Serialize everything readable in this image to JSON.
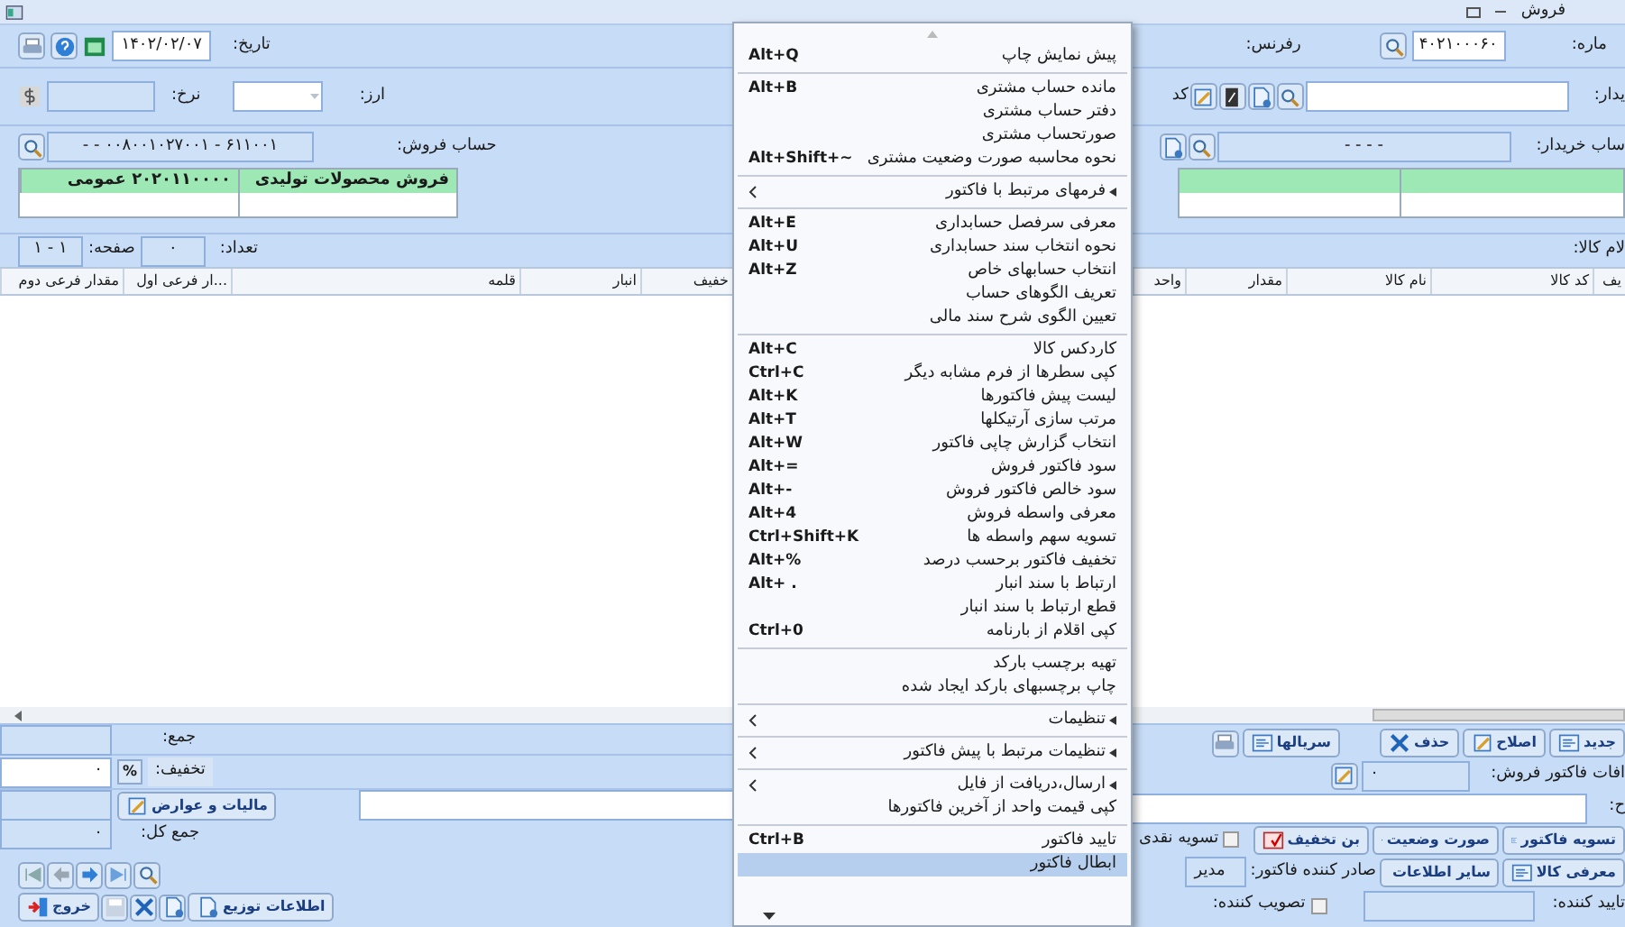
{
  "window": {
    "title": "فروش"
  },
  "date": {
    "label": "تاریخ:",
    "value": "۱۴۰۲/۰۲/۰۷"
  },
  "number": {
    "label": "ماره:",
    "value": "۴۰۲۱۰۰۰۶۰"
  },
  "reference": {
    "label": "رفرنس:"
  },
  "currency": {
    "label": "ارز:"
  },
  "rate": {
    "label": "نرخ:"
  },
  "buyer": {
    "label": "یدار:",
    "code_label": "کد"
  },
  "sales_account": {
    "label": "حساب فروش:",
    "value": "۶۱۱۰۰۱ - ۰۰۸۰۰۱۰۲۷۰۰۱ - -",
    "table": [
      "فروش محصولات تولیدی",
      "۲۰۲۰۱۱۰۰۰۰ عمومی"
    ]
  },
  "buyer_account": {
    "label": "ساب خریدار:",
    "value": "- - - -"
  },
  "paging": {
    "page": "۱ - ۱",
    "page_label": "صفحه:",
    "count": "۰",
    "count_label": "تعداد:"
  },
  "items_label": "لام کالا:",
  "table": {
    "columns": [
      "یف",
      "کد کالا",
      "نام کالا",
      "مقدار",
      "واحد",
      "خفیف",
      "انبار",
      "قلمه",
      "...ار فرعی اول",
      "مقدار فرعی دوم"
    ]
  },
  "totals": {
    "sum_label": "جمع:",
    "discount_label": "تخفیف:",
    "discount_percent": "%",
    "discount_value": "۰",
    "taxes_button": "مالیات و عوارض",
    "grand_total_label": "جمع کل:",
    "grand_total": "۰"
  },
  "exit_button": "خروج",
  "distribution_button": "اطلاعات توزیع",
  "actions": [
    "جدید",
    "اصلاح",
    "حذف",
    "سریالها"
  ],
  "additions": {
    "label": "افات فاکتور فروش:",
    "value": "۰"
  },
  "description_label": "ح:",
  "settle_buttons": [
    "تسویه فاکتور",
    "صورت وضعیت",
    "بن تخفیف"
  ],
  "info_buttons": [
    "معرفی کالا",
    "سایر اطلاعات"
  ],
  "cash_settlement": {
    "label": "تسویه نقدی",
    "checked": false
  },
  "issuer": {
    "label": "صادر کننده فاکتور:",
    "value": "مدیر"
  },
  "approver_label": "تایید کننده:",
  "ratifier": {
    "label": "تصویب کننده:",
    "checked": false
  },
  "menu": {
    "items": [
      {
        "kind": "item",
        "label": "پیش نمایش چاپ",
        "shortcut": "Alt+Q",
        "selected": false
      },
      {
        "kind": "separator"
      },
      {
        "kind": "item",
        "label": "مانده حساب مشتری",
        "shortcut": "Alt+B",
        "selected": false
      },
      {
        "kind": "item",
        "label": "دفتر حساب مشتری",
        "selected": false
      },
      {
        "kind": "item",
        "label": "صورتحساب مشتری",
        "selected": false
      },
      {
        "kind": "item",
        "label": "نحوه محاسبه صورت وضعیت مشتری",
        "shortcut": "Alt+Shift+~",
        "selected": false
      },
      {
        "kind": "separator"
      },
      {
        "kind": "submenu",
        "label": "فرمهای مرتبط با فاکتور",
        "selected": false
      },
      {
        "kind": "separator"
      },
      {
        "kind": "item",
        "label": "معرفی سرفصل حسابداری",
        "shortcut": "Alt+E",
        "selected": false
      },
      {
        "kind": "item",
        "label": "نحوه انتخاب سند حسابداری",
        "shortcut": "Alt+U",
        "selected": false
      },
      {
        "kind": "item",
        "label": "انتخاب حسابهای خاص",
        "shortcut": "Alt+Z",
        "selected": false
      },
      {
        "kind": "item",
        "label": "تعریف الگوهای حساب",
        "selected": false
      },
      {
        "kind": "item",
        "label": "تعیین الگوی شرح سند مالی",
        "selected": false
      },
      {
        "kind": "separator"
      },
      {
        "kind": "item",
        "label": "کاردکس کالا",
        "shortcut": "Alt+C",
        "selected": false
      },
      {
        "kind": "item",
        "label": "کپی سطرها از فرم مشابه دیگر",
        "shortcut": "Ctrl+C",
        "selected": false
      },
      {
        "kind": "item",
        "label": "لیست پیش فاکتورها",
        "shortcut": "Alt+K",
        "selected": false
      },
      {
        "kind": "item",
        "label": "مرتب سازی آرتیکلها",
        "shortcut": "Alt+T",
        "selected": false
      },
      {
        "kind": "item",
        "label": "انتخاب گزارش چاپی فاکتور",
        "shortcut": "Alt+W",
        "selected": false
      },
      {
        "kind": "item",
        "label": "سود فاکتور فروش",
        "shortcut": "Alt+=",
        "selected": false
      },
      {
        "kind": "item",
        "label": "سود خالص فاکتور فروش",
        "shortcut": "Alt+-",
        "selected": false
      },
      {
        "kind": "item",
        "label": "معرفی واسطه فروش",
        "shortcut": "Alt+4",
        "selected": false
      },
      {
        "kind": "item",
        "label": "تسویه سهم واسطه ها",
        "shortcut": "Ctrl+Shift+K",
        "selected": false
      },
      {
        "kind": "item",
        "label": "تخفیف فاکتور برحسب درصد",
        "shortcut": "Alt+%",
        "selected": false
      },
      {
        "kind": "item",
        "label": "ارتباط با سند انبار",
        "shortcut": "Alt+ .",
        "selected": false
      },
      {
        "kind": "item",
        "label": "قطع ارتباط با سند انبار",
        "selected": false
      },
      {
        "kind": "item",
        "label": "کپی اقلام از بارنامه",
        "shortcut": "Ctrl+0",
        "selected": false
      },
      {
        "kind": "separator"
      },
      {
        "kind": "item",
        "label": "تهیه برچسب بارکد",
        "selected": false
      },
      {
        "kind": "item",
        "label": "چاپ برچسبهای بارکد ایجاد شده",
        "selected": false
      },
      {
        "kind": "separator"
      },
      {
        "kind": "submenu",
        "label": "تنظیمات",
        "selected": false
      },
      {
        "kind": "separator"
      },
      {
        "kind": "submenu",
        "label": "تنظیمات مرتبط با پیش فاکتور",
        "selected": false
      },
      {
        "kind": "separator"
      },
      {
        "kind": "submenu",
        "label": "ارسال،دریافت از فایل",
        "selected": false
      },
      {
        "kind": "item",
        "label": "کپی قیمت واحد از آخرین فاکتورها",
        "selected": false
      },
      {
        "kind": "separator"
      },
      {
        "kind": "item",
        "label": "تایید فاکتور",
        "shortcut": "Ctrl+B",
        "selected": false
      },
      {
        "kind": "item",
        "label": "ابطال فاکتور",
        "selected": true
      }
    ]
  }
}
